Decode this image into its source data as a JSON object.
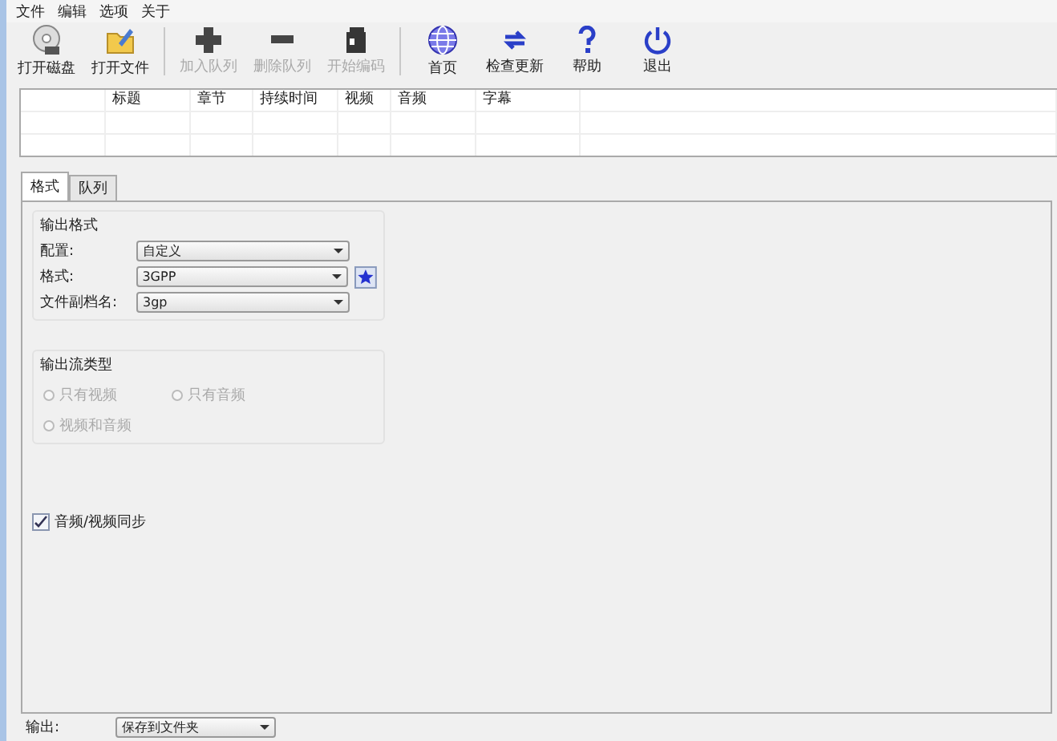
{
  "menu": [
    "文件",
    "编辑",
    "选项",
    "关于"
  ],
  "toolbar": {
    "groups": [
      [
        {
          "label": "打开磁盘",
          "disabled": false
        },
        {
          "label": "打开文件",
          "disabled": false
        }
      ],
      [
        {
          "label": "加入队列",
          "disabled": true
        },
        {
          "label": "删除队列",
          "disabled": true
        },
        {
          "label": "开始编码",
          "disabled": true
        }
      ],
      [
        {
          "label": "首页",
          "disabled": false
        },
        {
          "label": "检查更新",
          "disabled": false
        },
        {
          "label": "帮助",
          "disabled": false
        },
        {
          "label": "退出",
          "disabled": false
        }
      ]
    ]
  },
  "table": {
    "columns": [
      "标题",
      "章节",
      "持续时间",
      "视频",
      "音频",
      "字幕"
    ]
  },
  "tabs": [
    {
      "label": "格式",
      "selected": true
    },
    {
      "label": "队列",
      "selected": false
    }
  ],
  "output_format": {
    "title": "输出格式",
    "fields": [
      {
        "label": "配置:",
        "value": "自定义",
        "favorite": false
      },
      {
        "label": "格式:",
        "value": "3GPP",
        "favorite": true
      },
      {
        "label": "文件副档名:",
        "value": "3gp",
        "favorite": false
      }
    ]
  },
  "stream_type": {
    "title": "输出流类型",
    "disabled": true,
    "options": [
      {
        "label": "只有视频",
        "selected": false
      },
      {
        "label": "只有音频",
        "selected": false
      },
      {
        "label": "视频和音频",
        "selected": false
      }
    ]
  },
  "sync": {
    "label": "音频/视频同步",
    "checked": true
  },
  "output": {
    "label": "输出:",
    "value": "保存到文件夹"
  }
}
